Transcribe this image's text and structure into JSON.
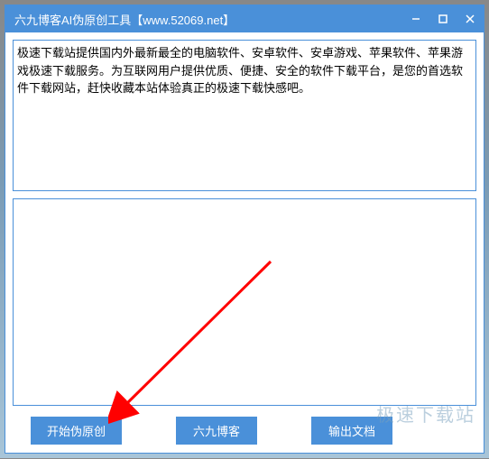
{
  "window": {
    "title": "六九博客AI伪原创工具【www.52069.net】"
  },
  "textareas": {
    "top_value": "极速下载站提供国内外最新最全的电脑软件、安卓软件、安卓游戏、苹果软件、苹果游戏极速下载服务。为互联网用户提供优质、便捷、安全的软件下载平台，是您的首选软件下载网站，赶快收藏本站体验真正的极速下载快感吧。",
    "bottom_value": ""
  },
  "buttons": {
    "start": "开始伪原创",
    "blog": "六九博客",
    "export": "输出文档"
  },
  "watermark": "极速下载站"
}
